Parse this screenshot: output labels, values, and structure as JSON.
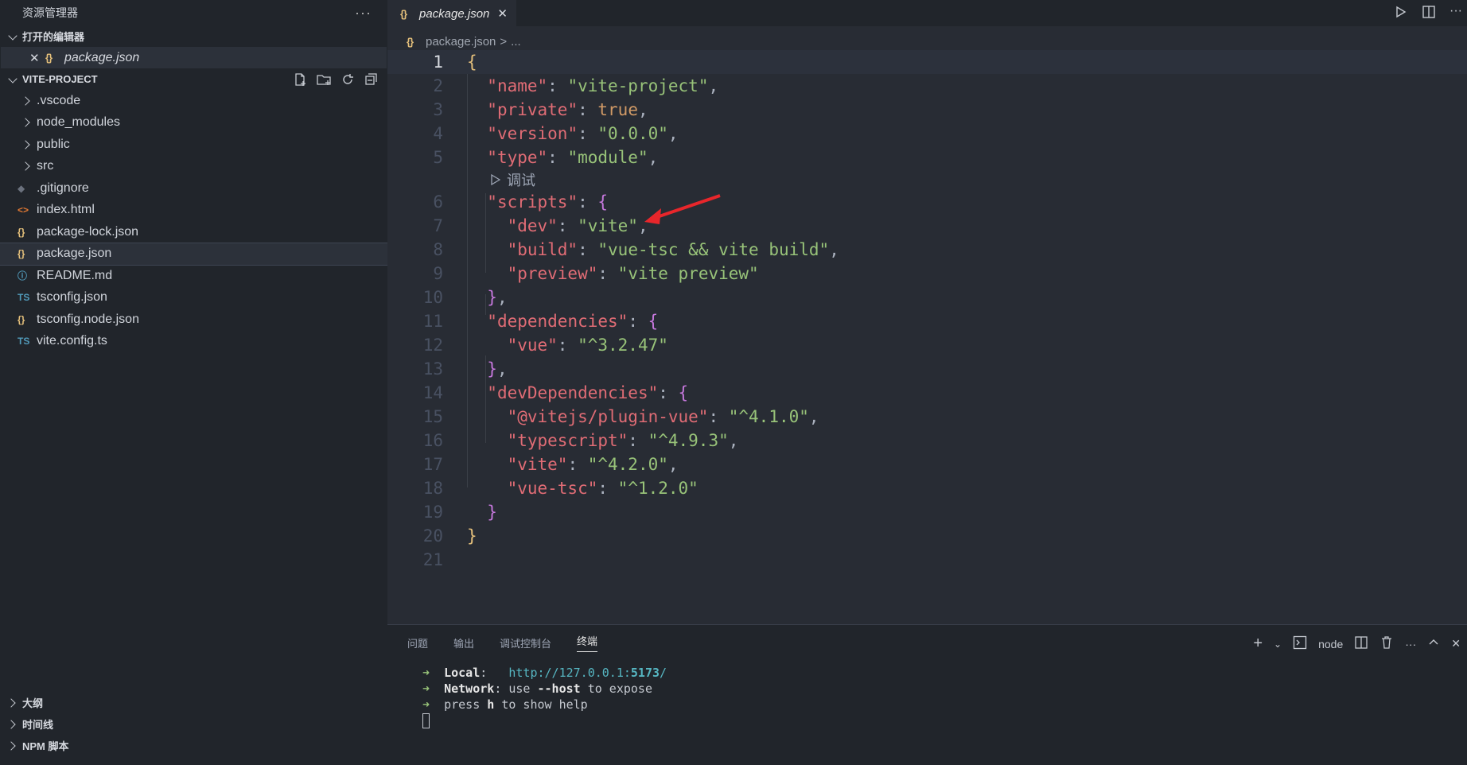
{
  "sidebar": {
    "title": "资源管理器",
    "more": "···",
    "open_editors_label": "打开的编辑器",
    "open_editor": {
      "close": "✕",
      "icon": "{}",
      "name": "package.json"
    },
    "project_label": "VITE-PROJECT",
    "folders": [
      ".vscode",
      "node_modules",
      "public",
      "src"
    ],
    "files": [
      {
        "name": ".gitignore",
        "icon": "◆",
        "color": "#6b717d"
      },
      {
        "name": "index.html",
        "icon": "<>",
        "color": "#e37933"
      },
      {
        "name": "package-lock.json",
        "icon": "{}",
        "color": "#e5c07b"
      },
      {
        "name": "package.json",
        "icon": "{}",
        "color": "#e5c07b"
      },
      {
        "name": "README.md",
        "icon": "ⓘ",
        "color": "#519aba"
      },
      {
        "name": "tsconfig.json",
        "icon": "TS",
        "color": "#519aba"
      },
      {
        "name": "tsconfig.node.json",
        "icon": "{}",
        "color": "#e5c07b"
      },
      {
        "name": "vite.config.ts",
        "icon": "TS",
        "color": "#519aba"
      }
    ],
    "bottom_sections": [
      "大纲",
      "时间线",
      "NPM 脚本"
    ]
  },
  "editor": {
    "tab": {
      "icon": "{}",
      "name": "package.json",
      "close": "✕"
    },
    "breadcrumb": {
      "icon": "{}",
      "file": "package.json",
      "sep": ">",
      "rest": "..."
    },
    "code_lens": "调试",
    "line_numbers": [
      "1",
      "2",
      "3",
      "4",
      "5",
      "6",
      "7",
      "8",
      "9",
      "10",
      "11",
      "12",
      "13",
      "14",
      "15",
      "16",
      "17",
      "18",
      "19",
      "20",
      "21"
    ]
  },
  "panel": {
    "tabs": [
      "问题",
      "输出",
      "调试控制台",
      "终端"
    ],
    "active_tab": "终端",
    "terminal_name": "node",
    "terminal": {
      "local_label": "Local",
      "local_url_pre": "http://127.0.0.1:",
      "local_url_port": "5173",
      "local_url_post": "/",
      "network_label": "Network",
      "network_text": "use ",
      "network_flag": "--host",
      "network_post": " to expose",
      "press_pre": "press ",
      "press_key": "h",
      "press_post": " to show help"
    }
  },
  "colors": {
    "accent_annotation": "#e8262b"
  }
}
